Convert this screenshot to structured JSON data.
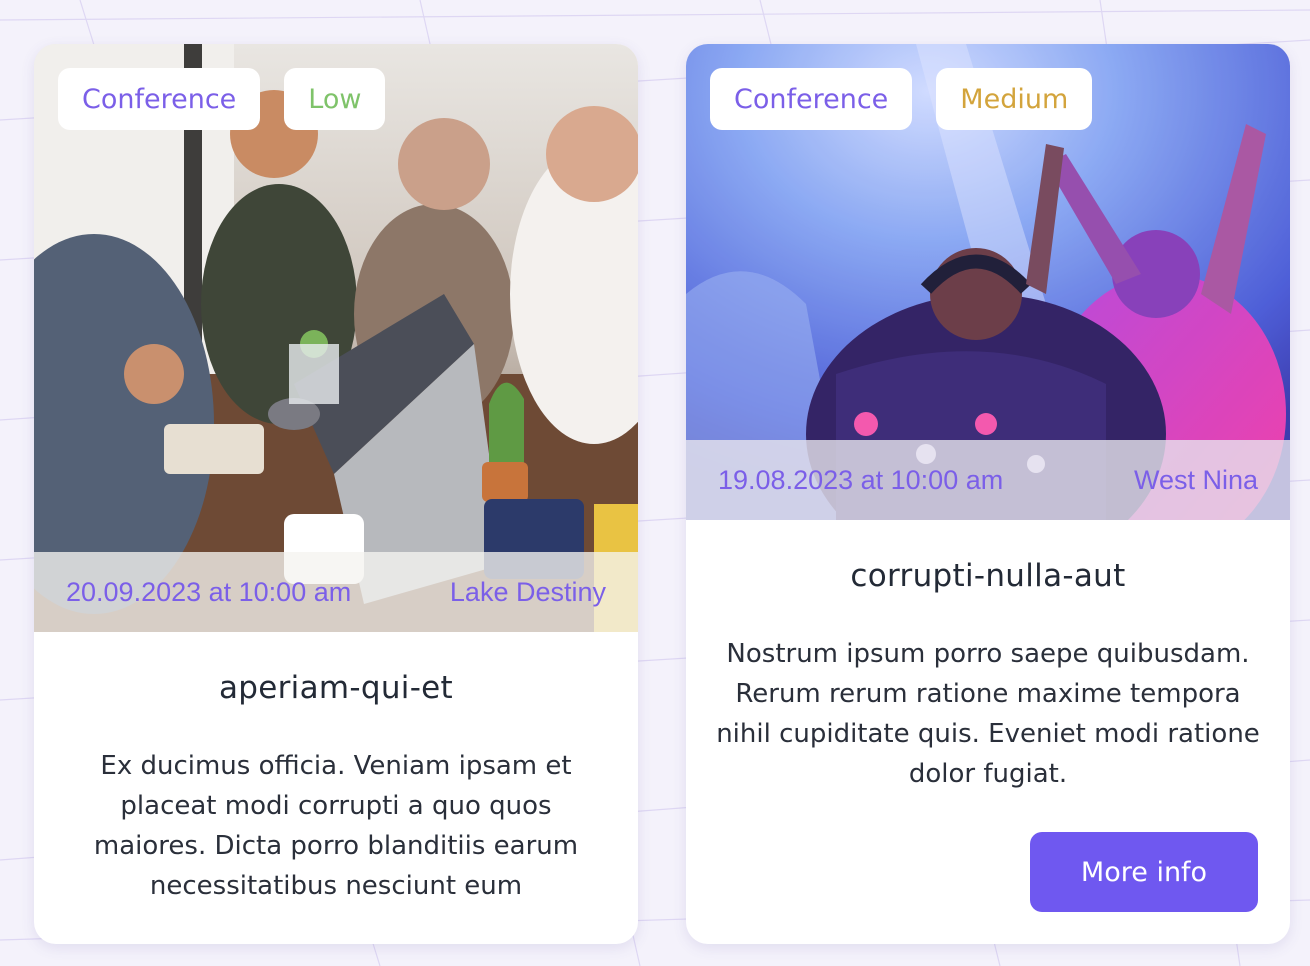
{
  "cards": [
    {
      "tags": [
        {
          "label": "Conference",
          "kind": "category"
        },
        {
          "label": "Low",
          "kind": "priority",
          "color": "#7fc36a"
        }
      ],
      "date": "20.09.2023 at 10:00 am",
      "location": "Lake Destiny",
      "title": "aperiam-qui-et",
      "description": "Ex ducimus officia. Veniam ipsam et placeat modi corrupti a quo quos maiores. Dicta porro blanditiis earum necessitatibus nesciunt eum",
      "image": "meeting-photo"
    },
    {
      "tags": [
        {
          "label": "Conference",
          "kind": "category"
        },
        {
          "label": "Medium",
          "kind": "priority",
          "color": "#d3a43c"
        }
      ],
      "date": "19.08.2023 at 10:00 am",
      "location": "West Nina",
      "title": "corrupti-nulla-aut",
      "description": "Nostrum ipsum porro saepe quibusdam. Rerum rerum ratione maxime tempora nihil cupiditate quis. Eveniet modi ratione dolor fugiat.",
      "image": "party-photo",
      "button_label": "More info"
    }
  ],
  "colors": {
    "accent": "#6f58f0",
    "tag_text": "#7b5fe8",
    "low": "#7fc36a",
    "medium": "#d3a43c"
  }
}
